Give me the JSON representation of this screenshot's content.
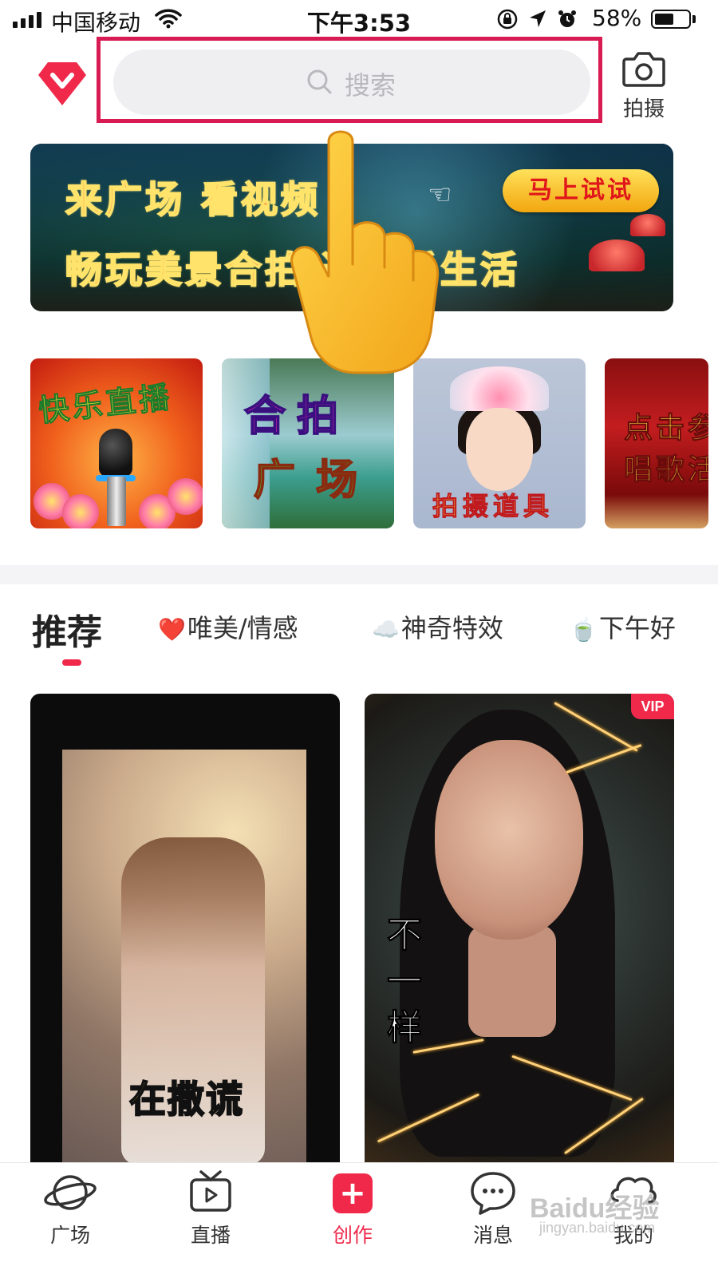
{
  "status_bar": {
    "carrier": "中国移动",
    "time": "下午3:53",
    "battery_percent": "58%",
    "battery_level": 0.58,
    "icons": [
      "signal-icon",
      "wifi-icon",
      "orientation-lock-icon",
      "location-icon",
      "alarm-icon",
      "battery-icon"
    ]
  },
  "header": {
    "search_placeholder": "搜索",
    "camera_label": "拍摄",
    "highlight_color": "#d81b52"
  },
  "banner": {
    "line1": "来广场 看视频",
    "line2": "畅玩美景合拍 过快乐生活",
    "cta": "马上试试",
    "pointer_glyph": "☜"
  },
  "categories": [
    {
      "label": "快乐直播"
    },
    {
      "label_line1": "合拍",
      "label_line2": "广场"
    },
    {
      "label": "拍摄道具"
    },
    {
      "label_line1": "点击参",
      "label_line2": "唱歌活"
    }
  ],
  "tabs": {
    "active": "推荐",
    "items": [
      {
        "icon": "❤️",
        "label": "唯美/情感"
      },
      {
        "icon": "☁️",
        "label": "神奇特效"
      },
      {
        "icon": "🍵",
        "label": "下午好"
      }
    ]
  },
  "videos": [
    {
      "caption": "在撒谎",
      "vip": false
    },
    {
      "caption": "不一样",
      "vip": true,
      "badge": "VIP"
    }
  ],
  "bottom_nav": [
    {
      "label": "广场",
      "icon": "planet-icon",
      "active": false
    },
    {
      "label": "直播",
      "icon": "tv-icon",
      "active": false
    },
    {
      "label": "创作",
      "icon": "plus-icon",
      "active": true
    },
    {
      "label": "消息",
      "icon": "message-icon",
      "active": false
    },
    {
      "label": "我的",
      "icon": "profile-icon",
      "active": false
    }
  ],
  "watermark": {
    "main": "Baidu经验",
    "sub": "jingyan.baidu.com"
  },
  "colors": {
    "accent": "#f0294a",
    "search_bg": "#efeff1"
  }
}
